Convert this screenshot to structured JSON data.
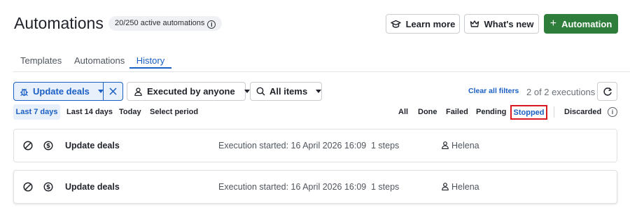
{
  "header": {
    "title": "Automations",
    "active_count": "20/250 active automations",
    "learn_more": "Learn more",
    "whats_new": "What's new",
    "add_automation": "Automation"
  },
  "tabs": [
    {
      "label": "Templates"
    },
    {
      "label": "Automations"
    },
    {
      "label": "History"
    }
  ],
  "active_tab": "History",
  "filters": {
    "automation": "Update deals",
    "executed_by": "Executed by anyone",
    "items": "All items",
    "clear_all": "Clear all filters",
    "execution_count": "2 of 2 executions"
  },
  "periods": [
    "Last 7 days",
    "Last 14 days",
    "Today",
    "Select period"
  ],
  "active_period": "Last 7 days",
  "statuses": [
    "All",
    "Done",
    "Failed",
    "Pending",
    "Stopped",
    "Discarded"
  ],
  "active_status": "Stopped",
  "executions": [
    {
      "status_icon": "stopped-icon",
      "type_icon": "money-icon",
      "name": "Update deals",
      "started": "Execution started: 16 April 2026 16:09",
      "steps": "1 steps",
      "user": "Helena"
    },
    {
      "status_icon": "stopped-icon",
      "type_icon": "money-icon",
      "name": "Update deals",
      "started": "Execution started: 16 April 2026 16:09",
      "steps": "1 steps",
      "user": "Helena"
    }
  ],
  "colors": {
    "accent": "#1a5fc4",
    "primary_button": "#2e7d3a",
    "highlight_border": "#d9181f"
  }
}
